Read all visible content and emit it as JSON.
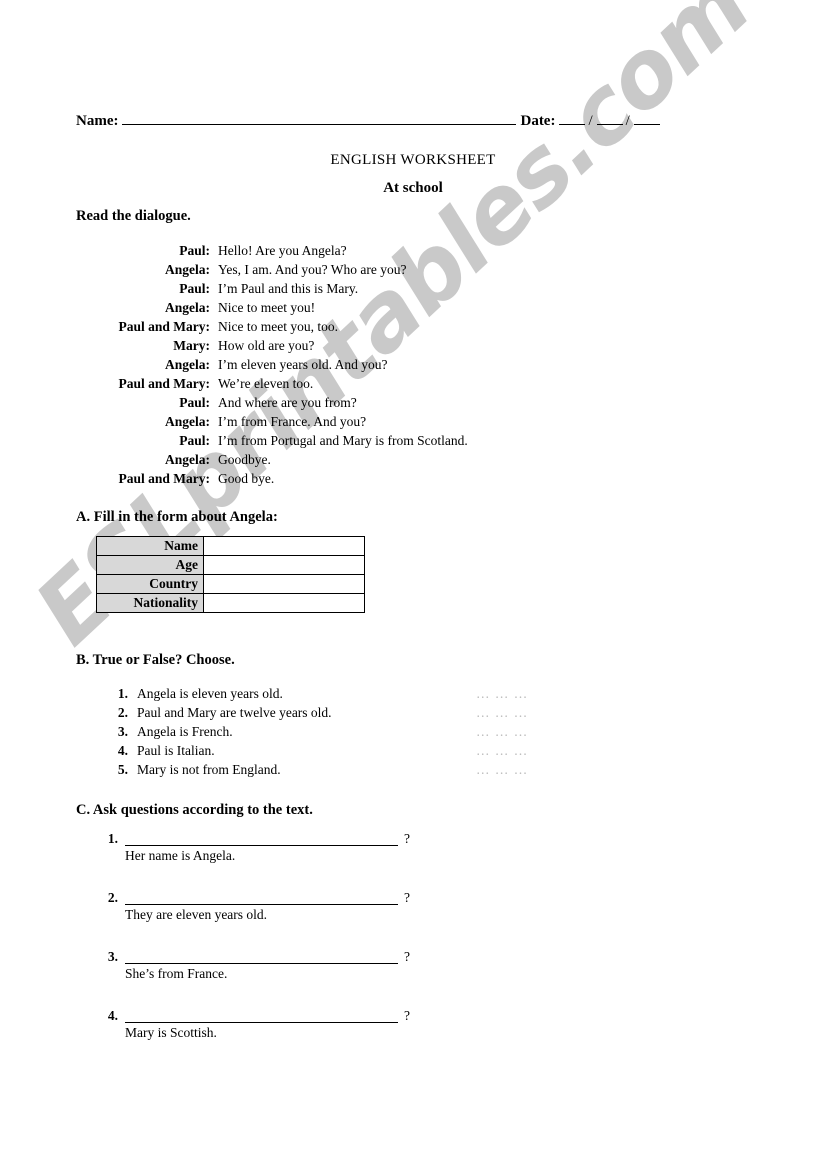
{
  "header": {
    "name_label": "Name:",
    "date_label": "Date:",
    "date_separator": "/"
  },
  "title": {
    "main": "ENGLISH WORKSHEET",
    "sub": "At school"
  },
  "sections": {
    "read_heading": "Read the dialogue.",
    "a_heading": "A. Fill in the form about Angela:",
    "b_heading": "B. True or False? Choose.",
    "c_heading": "C. Ask questions according to the text."
  },
  "dialogue": [
    {
      "speaker": "Paul:",
      "text": "Hello! Are you Angela?"
    },
    {
      "speaker": "Angela:",
      "text": "Yes, I am. And you? Who are you?"
    },
    {
      "speaker": "Paul:",
      "text": "I’m Paul and this is Mary."
    },
    {
      "speaker": "Angela:",
      "text": "Nice to meet you!"
    },
    {
      "speaker": "Paul and Mary:",
      "text": "Nice to meet you, too."
    },
    {
      "speaker": "Mary:",
      "text": "How old are you?"
    },
    {
      "speaker": "Angela:",
      "text": "I’m eleven years old. And you?"
    },
    {
      "speaker": "Paul and Mary:",
      "text": "We’re eleven too."
    },
    {
      "speaker": "Paul:",
      "text": "And where are you from?"
    },
    {
      "speaker": "Angela:",
      "text": "I’m from France. And you?"
    },
    {
      "speaker": "Paul:",
      "text": "I’m from Portugal and Mary is from Scotland."
    },
    {
      "speaker": "Angela:",
      "text": "Goodbye."
    },
    {
      "speaker": "Paul and Mary:",
      "text": "Good bye."
    }
  ],
  "form_table": {
    "rows": [
      {
        "label": "Name",
        "value": ""
      },
      {
        "label": "Age",
        "value": ""
      },
      {
        "label": "Country",
        "value": ""
      },
      {
        "label": "Nationality",
        "value": ""
      }
    ]
  },
  "true_false": {
    "answer_blank": "… … …",
    "items": [
      {
        "num": "1.",
        "text": "Angela is eleven years old."
      },
      {
        "num": "2.",
        "text": "Paul and Mary are twelve years old."
      },
      {
        "num": "3.",
        "text": "Angela is French."
      },
      {
        "num": "4.",
        "text": "Paul is Italian."
      },
      {
        "num": "5.",
        "text": "Mary is not from England."
      }
    ]
  },
  "questions": {
    "question_mark": "?",
    "items": [
      {
        "num": "1.",
        "answer": "Her name is Angela."
      },
      {
        "num": "2.",
        "answer": "They are eleven years old."
      },
      {
        "num": "3.",
        "answer": "She’s from France."
      },
      {
        "num": "4.",
        "answer": "Mary is Scottish."
      }
    ]
  },
  "watermark": {
    "text": "ESLprintables.com",
    "color": "#c9c9c9"
  }
}
